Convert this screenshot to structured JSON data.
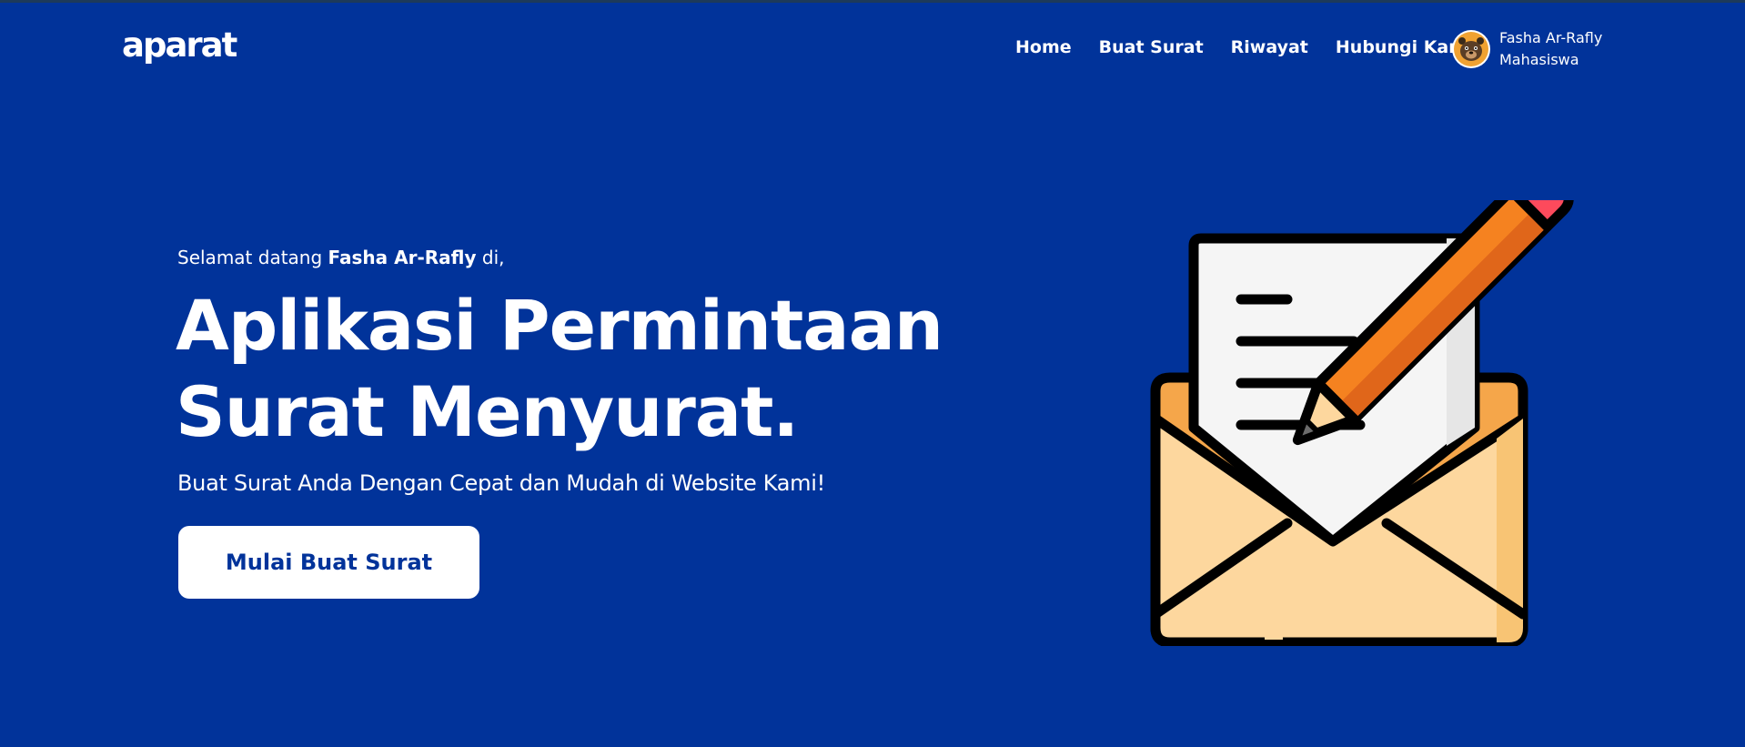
{
  "brand": {
    "logo_text": "aparat"
  },
  "nav": {
    "items": [
      {
        "label": "Home"
      },
      {
        "label": "Buat Surat"
      },
      {
        "label": "Riwayat"
      },
      {
        "label": "Hubungi Kami"
      }
    ]
  },
  "user": {
    "name": "Fasha Ar-Rafly",
    "role": "Mahasiswa",
    "avatar_icon": "bear-avatar-icon"
  },
  "hero": {
    "greeting_prefix": "Selamat datang",
    "greeting_name": "Fasha Ar-Rafly",
    "greeting_suffix": "di,",
    "title_line1": "Aplikasi Permintaan",
    "title_line2": "Surat Menyurat.",
    "subtitle": "Buat Surat Anda Dengan Cepat dan Mudah di Website Kami!",
    "cta_label": "Mulai Buat Surat",
    "illustration_icon": "envelope-letter-pencil-icon"
  },
  "colors": {
    "background": "#01339a",
    "text": "#ffffff",
    "cta_background": "#ffffff",
    "cta_text": "#01339a",
    "envelope": "#fdd79e",
    "envelope_flap": "#f5a64a",
    "pencil": "#f58220",
    "pencil_tip": "#fd4a5c",
    "paper": "#f5f5f5"
  }
}
